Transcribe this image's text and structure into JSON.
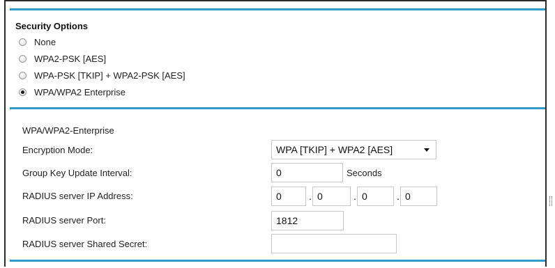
{
  "security_options": {
    "title": "Security Options",
    "options": [
      {
        "label": "None",
        "checked": false
      },
      {
        "label": "WPA2-PSK [AES]",
        "checked": false
      },
      {
        "label": "WPA-PSK [TKIP] + WPA2-PSK [AES]",
        "checked": false
      },
      {
        "label": "WPA/WPA2 Enterprise",
        "checked": true
      }
    ]
  },
  "enterprise": {
    "title": "WPA/WPA2-Enterprise",
    "encryption_mode": {
      "label": "Encryption Mode:",
      "value": "WPA [TKIP] + WPA2 [AES]"
    },
    "group_key_interval": {
      "label": "Group Key Update Interval:",
      "value": "0",
      "unit": "Seconds"
    },
    "radius_ip": {
      "label": "RADIUS server IP Address:",
      "octets": [
        "0",
        "0",
        "0",
        "0"
      ],
      "separator": "."
    },
    "radius_port": {
      "label": "RADIUS server Port:",
      "value": "1812"
    },
    "radius_secret": {
      "label": "RADIUS server Shared Secret:",
      "value": ""
    }
  },
  "colors": {
    "accent_rule": "#2f9bc6"
  }
}
